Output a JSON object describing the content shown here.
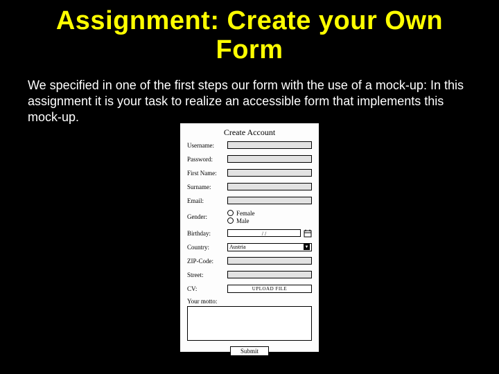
{
  "slide": {
    "title": "Assignment: Create your Own Form",
    "body": "We specified in one of the first steps our form with the use of a mock-up: In this assignment it is your task to realize an accessible form that implements this mock-up."
  },
  "mockup": {
    "title": "Create Account",
    "fields": {
      "username": "Username:",
      "password": "Password:",
      "firstname": "First Name:",
      "surname": "Surname:",
      "email": "Email:",
      "gender": "Gender:",
      "gender_female": "Female",
      "gender_male": "Male",
      "birthday": "Birthday:",
      "birthday_format": "/ /",
      "country": "Country:",
      "country_value": "Austria",
      "zip": "ZIP-Code:",
      "street": "Street:",
      "cv": "CV:",
      "cv_button": "UPLOAD FILE",
      "motto": "Your motto:",
      "submit": "Submit"
    }
  }
}
